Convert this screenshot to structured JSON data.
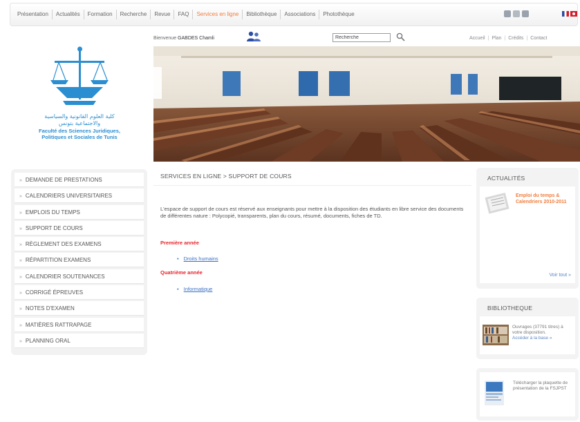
{
  "nav": {
    "items": [
      {
        "label": "Présentation"
      },
      {
        "label": "Actualités"
      },
      {
        "label": "Formation"
      },
      {
        "label": "Recherche"
      },
      {
        "label": "Revue"
      },
      {
        "label": "FAQ"
      },
      {
        "label": "Services en ligne",
        "active": true
      },
      {
        "label": "Bibliothèque"
      },
      {
        "label": "Associations"
      },
      {
        "label": "Photothèque"
      }
    ],
    "tools": [
      "email-icon",
      "print-icon",
      "share-icon"
    ],
    "languages": [
      "fr-flag-icon",
      "tn-flag-icon"
    ]
  },
  "logo": {
    "arabic_line1": "كلية العلوم القانونية والسياسية",
    "arabic_line2": "والاجتماعية بتونس",
    "fr_line1": "Faculté des Sciences Juridiques,",
    "fr_line2": "Politiques et Sociales de Tunis"
  },
  "header": {
    "welcome_prefix": "Bienvenue",
    "welcome_user": "GABDES Chamli",
    "search_value": "Recherche",
    "util_links": [
      "Accueil",
      "Plan",
      "Crédits",
      "Contact"
    ]
  },
  "sidebar": {
    "items": [
      {
        "label": "DEMANDE DE PRESTATIONS"
      },
      {
        "label": "CALENDRIERS UNIVERSITAIRES"
      },
      {
        "label": "EMPLOIS DU TEMPS"
      },
      {
        "label": "SUPPORT DE COURS"
      },
      {
        "label": "RÈGLEMENT DES EXAMENS"
      },
      {
        "label": "RÉPARTITION EXAMENS"
      },
      {
        "label": "CALENDRIER SOUTENANCES"
      },
      {
        "label": "CORRIGÉ ÉPREUVES"
      },
      {
        "label": "NOTES D'EXAMEN"
      },
      {
        "label": "MATIÈRES RATTRAPAGE"
      },
      {
        "label": "PLANNING ORAL"
      }
    ]
  },
  "main": {
    "breadcrumb": "SERVICES EN LIGNE > SUPPORT DE COURS",
    "intro": "L'espace de support de cours est réservé aux enseignants pour mettre à la disposition des étudiants en libre service des documents de différentes nature : Polycopié, transparents, plan du cours, résumé, documents, fiches de TD.",
    "year1": "Première année",
    "course1": "Droits humains",
    "year2": "Quatrième année",
    "course2": "Informatique"
  },
  "right": {
    "news_title": "ACTUALITÉS",
    "news_item": "Emploi du temps & Calendriers 2010-2011",
    "news_more": "Voir tout »",
    "biblio_title": "BIBLIOTHEQUE",
    "biblio_text": "Ouvrages (37791 titres) à votre disposition.",
    "biblio_link": "Accéder à la base »",
    "plaquette_text": "Télécharger la plaquette de présentation de la FSJPST"
  }
}
